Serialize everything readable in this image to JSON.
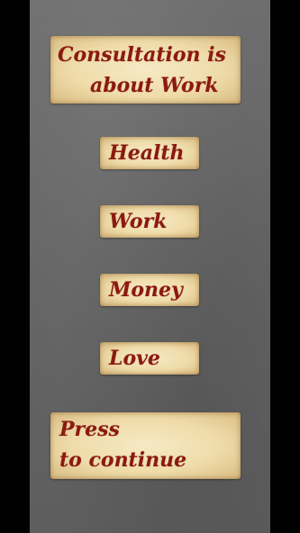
{
  "header": {
    "line1": "Consultation is",
    "line2": "about Work"
  },
  "options": {
    "health": "Health",
    "work": "Work",
    "money": "Money",
    "love": "Love"
  },
  "continue_button": {
    "line1": "Press",
    "line2": "to continue"
  },
  "colors": {
    "text": "#8b1a10",
    "parchment": "#efdcaa",
    "panel": "#646464",
    "background": "#000000"
  }
}
